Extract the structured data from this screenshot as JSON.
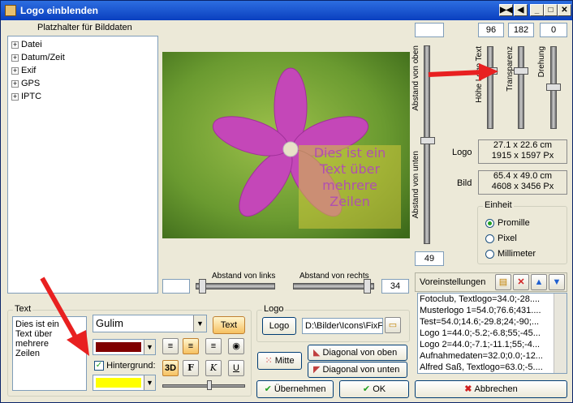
{
  "window": {
    "title": "Logo einblenden"
  },
  "tree": {
    "header": "Platzhalter für Bilddaten",
    "items": [
      "Datei",
      "Datum/Zeit",
      "Exif",
      "GPS",
      "IPTC"
    ]
  },
  "overlay_text": {
    "lines": [
      "Dies ist ein",
      "Text über",
      "mehrere",
      "Zeilen"
    ]
  },
  "labels": {
    "abstand_oben": "Abstand von oben",
    "abstand_unten": "Abstand von unten",
    "abstand_links": "Abstand von links",
    "abstand_rechts": "Abstand von rechts",
    "hoehe_logo_text": "Höhe Logo Text",
    "transparenz": "Transparenz",
    "drehung": "Drehung"
  },
  "values": {
    "top_blank": "",
    "hoehe": "96",
    "transparenz": "182",
    "drehung": "0",
    "unten": "49",
    "links": "",
    "rechts": "34"
  },
  "info": {
    "logo_label": "Logo",
    "logo_line1": "27.1 x 22.6 cm",
    "logo_line2": "1915 x 1597 Px",
    "bild_label": "Bild",
    "bild_line1": "65.4 x 49.0 cm",
    "bild_line2": "4608 x 3456 Px"
  },
  "einheit": {
    "title": "Einheit",
    "options": [
      "Promille",
      "Pixel",
      "Millimeter"
    ],
    "selected": "Promille"
  },
  "presets": {
    "title": "Voreinstellungen",
    "items": [
      "Fotoclub, Textlogo=34.0;-28....",
      "Musterlogo 1=54.0;76.6;431....",
      "Test=54.0;14.6;-29.8;24;-90;...",
      "Logo 1=44.0;-5.2;-6.8;55;-45...",
      "Logo 2=44.0;-7.1;-11.1;55;-4...",
      "Aufnahmedaten=32.0;0.0;-12...",
      "Alfred Saß, Textlogo=63.0;-5...."
    ]
  },
  "text_group": {
    "title": "Text",
    "content_lines": [
      "Dies ist ein",
      "Text über",
      "mehrere",
      "Zeilen"
    ],
    "font": "Gulim",
    "text_button": "Text",
    "hintergrund_label": "Hintergrund:",
    "btn_3d": "3D",
    "btn_bold": "F",
    "btn_italic": "K",
    "btn_underline": "U",
    "text_color": "#800000",
    "bg_color": "#ffff00"
  },
  "logo_group": {
    "title": "Logo",
    "logo_button": "Logo",
    "path": "D:\\Bilder\\Icons\\FixF"
  },
  "buttons": {
    "mitte": "Mitte",
    "diag_oben": "Diagonal von oben",
    "diag_unten": "Diagonal von unten",
    "uebernehmen": "Übernehmen",
    "ok": "OK",
    "abbrechen": "Abbrechen"
  }
}
